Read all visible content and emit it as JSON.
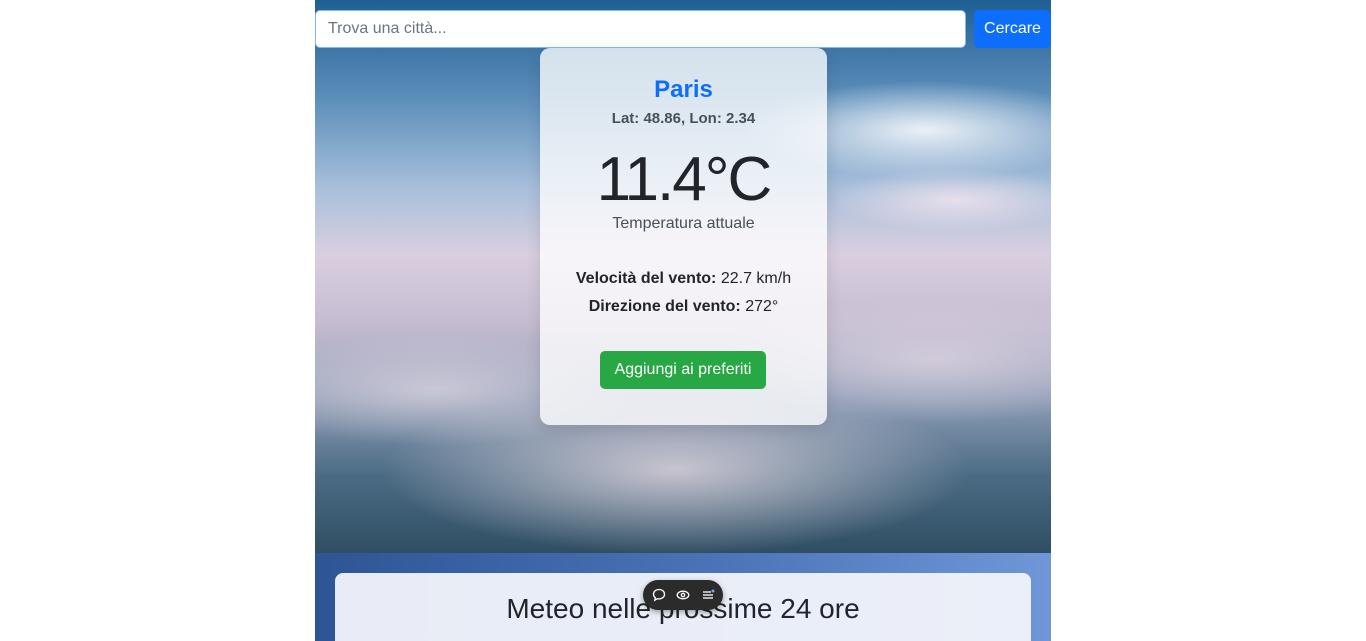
{
  "search": {
    "placeholder": "Trova una città...",
    "value": "",
    "button_label": "Cercare"
  },
  "weather": {
    "city": "Paris",
    "lat_label": "Lat: 48.86,",
    "lon_label": "Lon: 2.34",
    "temperature": "11.4°C",
    "temperature_caption": "Temperatura attuale",
    "wind_speed_label": "Velocità del vento:",
    "wind_speed_value": "22.7 km/h",
    "wind_direction_label": "Direzione del vento:",
    "wind_direction_value": "272°",
    "favorite_button": "Aggiungi ai preferiti"
  },
  "forecast": {
    "title": "Meteo nelle prossime 24 ore"
  },
  "toolbar": {
    "icons": [
      "comment-icon",
      "eye-icon",
      "list-icon"
    ]
  },
  "colors": {
    "primary": "#0d6efd",
    "success": "#28a745",
    "city_name": "#0d6efd"
  }
}
